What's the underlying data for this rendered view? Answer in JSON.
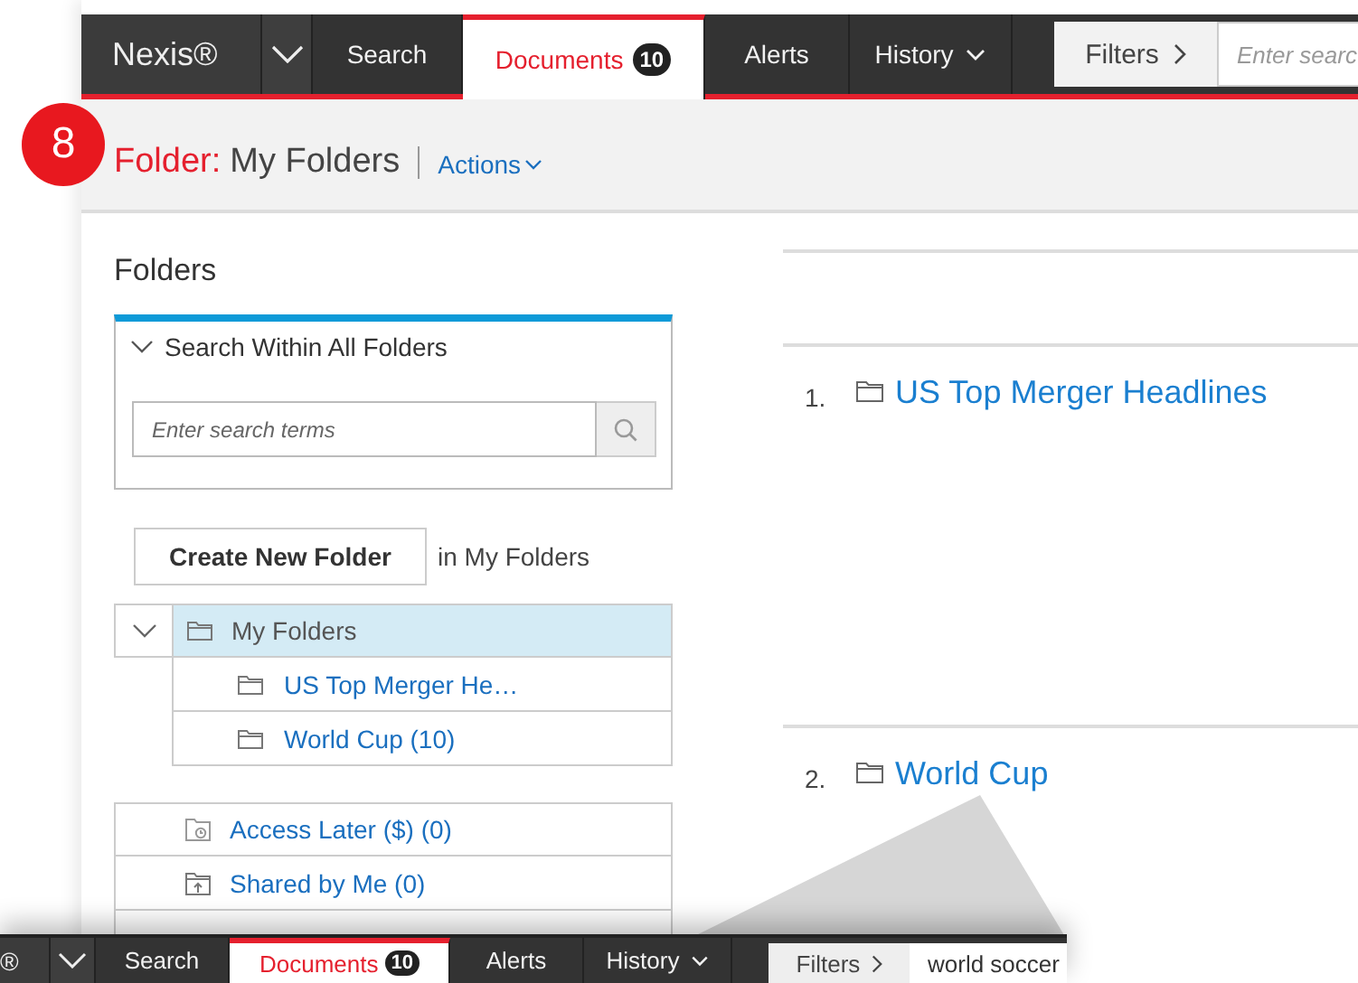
{
  "step_badge": "8",
  "navbar": {
    "logo": "Nexis®",
    "items": [
      {
        "label": "Search",
        "selected": false,
        "dropdown": false
      },
      {
        "label": "Documents",
        "badge": "10",
        "selected": true,
        "dropdown": false
      },
      {
        "label": "Alerts",
        "selected": false,
        "dropdown": false
      },
      {
        "label": "History",
        "selected": false,
        "dropdown": true
      }
    ],
    "filters": "Filters",
    "search": {
      "placeholder": "Enter searc"
    }
  },
  "page_header": {
    "label": "Folder:",
    "title": "My Folders",
    "actions": "Actions"
  },
  "folders_panel": {
    "title": "Folders",
    "search_section": {
      "title": "Search Within All Folders",
      "expanded": true,
      "placeholder": "Enter search terms"
    },
    "create_button": "Create New Folder",
    "create_note": "in My Folders",
    "tree": {
      "label": "My Folders",
      "expanded": true,
      "selected": true,
      "children": [
        {
          "label": "US Top Merger He…",
          "selected": false
        },
        {
          "label": "World Cup (10)",
          "selected": false
        }
      ]
    },
    "special_folders": [
      {
        "label": "Access Later ($) (0)",
        "kind": "clock"
      },
      {
        "label": "Shared by Me (0)",
        "kind": "shared"
      }
    ]
  },
  "results": [
    {
      "number": "1.",
      "title": "US Top Merger Headlines"
    },
    {
      "number": "2.",
      "title": "World Cup"
    }
  ],
  "zoom_inset": {
    "logo": "®",
    "items": [
      {
        "label": "Search",
        "selected": false,
        "dropdown": false
      },
      {
        "label": "Documents",
        "badge": "10",
        "selected": true,
        "dropdown": false
      },
      {
        "label": "Alerts",
        "selected": false,
        "dropdown": false
      },
      {
        "label": "History",
        "selected": false,
        "dropdown": true
      }
    ],
    "filters": "Filters",
    "search_value": "world soccer"
  }
}
